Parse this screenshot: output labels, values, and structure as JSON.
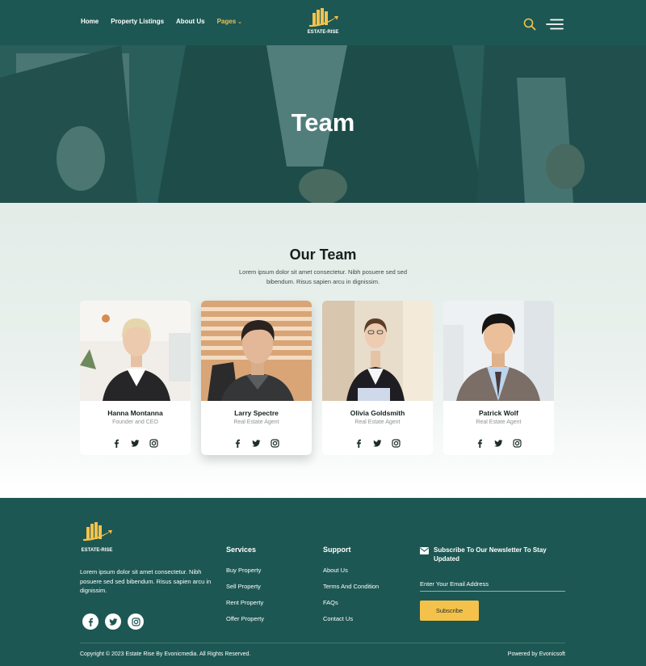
{
  "header": {
    "nav": [
      "Home",
      "Property Listings",
      "About Us",
      "Pages"
    ],
    "active_nav": "Pages",
    "logo_text": "ESTATE-RISE",
    "search_icon": "search-icon",
    "menu_icon": "hamburger-menu-icon"
  },
  "hero": {
    "title": "Team"
  },
  "team": {
    "title": "Our Team",
    "description": "Lorem ipsum dolor sit amet consectetur. Nibh posuere sed sed bibendum. Risus sapien arcu in dignissim.",
    "members": [
      {
        "name": "Hanna Montanna",
        "role": "Founder and CEO"
      },
      {
        "name": "Larry Spectre",
        "role": "Real Estate Agent"
      },
      {
        "name": "Olivia Goldsmith",
        "role": "Real Estate Agent"
      },
      {
        "name": "Patrick Wolf",
        "role": "Real Estate Agent"
      }
    ],
    "social_icons": [
      "facebook-icon",
      "twitter-icon",
      "instagram-icon"
    ]
  },
  "footer": {
    "logo_text": "ESTATE-RISE",
    "about": "Lorem ipsum dolor sit amet consectetur. Nibh posuere sed sed bibendum. Risus sapien arcu in dignissim.",
    "services": {
      "title": "Services",
      "links": [
        "Buy Property",
        "Sell Property",
        "Rent Property",
        "Offer Property"
      ]
    },
    "support": {
      "title": "Support",
      "links": [
        "About Us",
        "Terms And Condition",
        "FAQs",
        "Contact Us"
      ]
    },
    "newsletter": {
      "title": "Subscribe To Our Newsletter To Stay Updated",
      "placeholder": "Enter Your Email Address",
      "button": "Subscribe"
    },
    "copyright": "Copyright © 2023 Estate Rise By Evonicmedia. All Rights Reserved.",
    "powered": "Powered by Evonicsoft"
  },
  "colors": {
    "primary": "#1d5753",
    "accent": "#f4c24a",
    "section_bg": "#e3ece8"
  }
}
